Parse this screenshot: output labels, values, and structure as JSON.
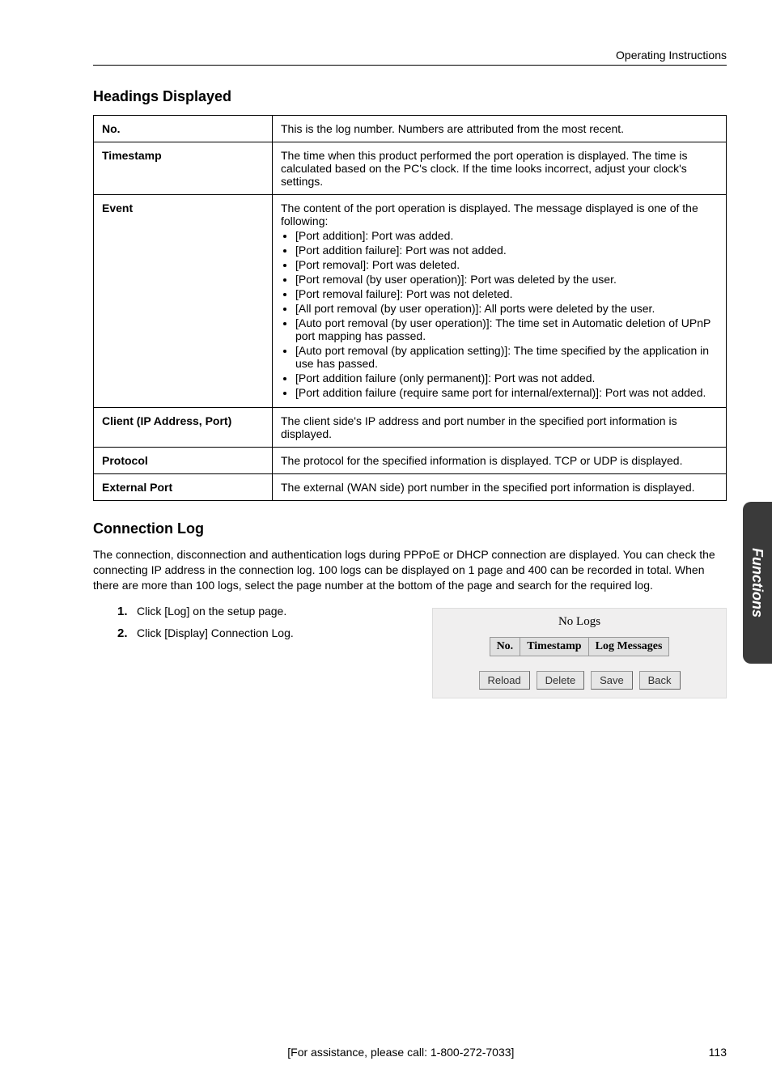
{
  "header": {
    "doctitle": "Operating Instructions"
  },
  "section1": {
    "title": "Headings Displayed"
  },
  "table": {
    "rows": [
      {
        "label": "No.",
        "desc": "This is the log number. Numbers are attributed from the most recent."
      },
      {
        "label": "Timestamp",
        "desc": "The time when this product performed the port operation is displayed. The time is calculated based on the PC's clock. If the time looks incorrect, adjust your clock's settings."
      },
      {
        "label": "Event",
        "desc_intro": "The content of the port operation is displayed. The message displayed is one of the following:",
        "bullets": [
          "[Port addition]: Port was added.",
          "[Port addition failure]: Port was not added.",
          "[Port removal]: Port was deleted.",
          "[Port removal (by user operation)]: Port was deleted by the user.",
          "[Port removal failure]: Port was not deleted.",
          "[All port removal (by user operation)]: All ports were deleted by the user.",
          "[Auto port removal (by user operation)]: The time set in Automatic deletion of UPnP port mapping has passed.",
          "[Auto port removal (by application setting)]: The time specified by the application in use has passed.",
          "[Port addition failure (only permanent)]: Port was not added.",
          "[Port addition failure (require same port for internal/external)]: Port was not added."
        ]
      },
      {
        "label": "Client (IP Address, Port)",
        "desc": "The client side's IP address and port number in the specified port information is displayed."
      },
      {
        "label": "Protocol",
        "desc": "The protocol for the specified information is displayed. TCP or UDP is displayed."
      },
      {
        "label": "External Port",
        "desc": "The external (WAN side) port number in the specified port information is displayed."
      }
    ]
  },
  "section2": {
    "title": "Connection Log",
    "body": "The connection, disconnection and authentication logs during PPPoE or DHCP connection are displayed. You can check the connecting IP address in the connection log. 100 logs can be displayed on 1 page and 400 can be recorded in total. When there are more than 100 logs, select the page number at the bottom of the page and search for the required log.",
    "steps": [
      {
        "num": "1.",
        "text": "Click [Log] on the setup page."
      },
      {
        "num": "2.",
        "text": "Click [Display] Connection Log."
      }
    ]
  },
  "screenshot": {
    "nologs": "No Logs",
    "cols": {
      "no": "No.",
      "ts": "Timestamp",
      "msg": "Log Messages"
    },
    "buttons": {
      "reload": "Reload",
      "delete": "Delete",
      "save": "Save",
      "back": "Back"
    }
  },
  "sidetab": "Functions",
  "footer": {
    "assist": "[For assistance, please call: 1-800-272-7033]",
    "page": "113"
  }
}
